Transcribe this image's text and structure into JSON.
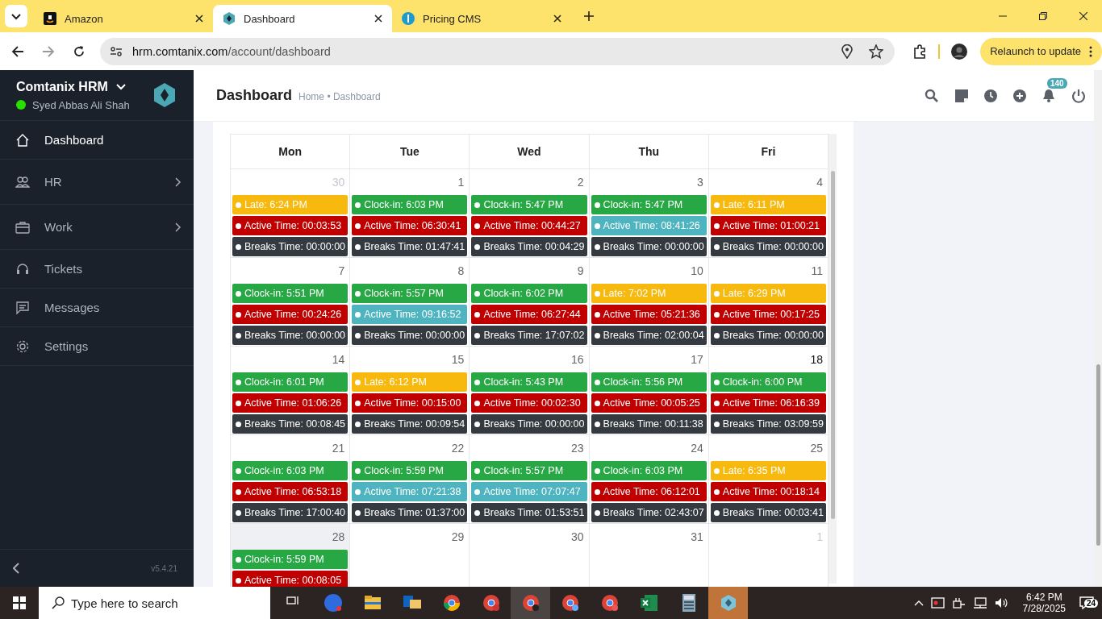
{
  "browser": {
    "tabs": [
      {
        "title": "Amazon",
        "selected": false
      },
      {
        "title": "Dashboard",
        "selected": true
      },
      {
        "title": "Pricing CMS",
        "selected": false
      }
    ],
    "url_host": "hrm.comtanix.com",
    "url_path": "/account/dashboard",
    "relaunch": "Relaunch to update"
  },
  "sidebar": {
    "app_name": "Comtanix HRM",
    "user": "Syed Abbas Ali Shah",
    "online": true,
    "items": [
      {
        "label": "Dashboard",
        "selected": true,
        "expandable": false
      },
      {
        "label": "HR",
        "selected": false,
        "expandable": true
      },
      {
        "label": "Work",
        "selected": false,
        "expandable": true
      },
      {
        "label": "Tickets",
        "selected": false,
        "expandable": false
      },
      {
        "label": "Messages",
        "selected": false,
        "expandable": false
      },
      {
        "label": "Settings",
        "selected": false,
        "expandable": false
      }
    ],
    "version": "v5.4.21"
  },
  "header": {
    "title": "Dashboard",
    "breadcrumb": "Home • Dashboard",
    "notifications": "140"
  },
  "calendar": {
    "columns": [
      "Mon",
      "Tue",
      "Wed",
      "Thu",
      "Fri"
    ],
    "weeks": [
      [
        {
          "day": "30",
          "muted": true,
          "today": false,
          "events": [
            {
              "text": "Late: 6:24 PM",
              "color": "#f8b90f"
            },
            {
              "text": "Active Time: 00:03:53",
              "color": "#c00000"
            },
            {
              "text": "Breaks Time: 00:00:00",
              "color": "#343a40"
            }
          ]
        },
        {
          "day": "1",
          "muted": false,
          "today": false,
          "events": [
            {
              "text": "Clock-in: 6:03 PM",
              "color": "#28a745"
            },
            {
              "text": "Active Time: 06:30:41",
              "color": "#c00000"
            },
            {
              "text": "Breaks Time: 01:47:41",
              "color": "#343a40"
            }
          ]
        },
        {
          "day": "2",
          "muted": false,
          "today": false,
          "events": [
            {
              "text": "Clock-in: 5:47 PM",
              "color": "#28a745"
            },
            {
              "text": "Active Time: 00:44:27",
              "color": "#c00000"
            },
            {
              "text": "Breaks Time: 00:04:29",
              "color": "#343a40"
            }
          ]
        },
        {
          "day": "3",
          "muted": false,
          "today": false,
          "events": [
            {
              "text": "Clock-in: 5:47 PM",
              "color": "#28a745"
            },
            {
              "text": "Active Time: 08:41:26",
              "color": "#4eb4bf"
            },
            {
              "text": "Breaks Time: 00:00:00",
              "color": "#343a40"
            }
          ]
        },
        {
          "day": "4",
          "muted": false,
          "today": false,
          "events": [
            {
              "text": "Late: 6:11 PM",
              "color": "#f8b90f"
            },
            {
              "text": "Active Time: 01:00:21",
              "color": "#c00000"
            },
            {
              "text": "Breaks Time: 00:00:00",
              "color": "#343a40"
            }
          ]
        }
      ],
      [
        {
          "day": "7",
          "muted": false,
          "today": false,
          "events": [
            {
              "text": "Clock-in: 5:51 PM",
              "color": "#28a745"
            },
            {
              "text": "Active Time: 00:24:26",
              "color": "#c00000"
            },
            {
              "text": "Breaks Time: 00:00:00",
              "color": "#343a40"
            }
          ]
        },
        {
          "day": "8",
          "muted": false,
          "today": false,
          "events": [
            {
              "text": "Clock-in: 5:57 PM",
              "color": "#28a745"
            },
            {
              "text": "Active Time: 09:16:52",
              "color": "#4eb4bf"
            },
            {
              "text": "Breaks Time: 00:00:00",
              "color": "#343a40"
            }
          ]
        },
        {
          "day": "9",
          "muted": false,
          "today": false,
          "events": [
            {
              "text": "Clock-in: 6:02 PM",
              "color": "#28a745"
            },
            {
              "text": "Active Time: 06:27:44",
              "color": "#c00000"
            },
            {
              "text": "Breaks Time: 17:07:02",
              "color": "#343a40"
            }
          ]
        },
        {
          "day": "10",
          "muted": false,
          "today": false,
          "events": [
            {
              "text": "Late: 7:02 PM",
              "color": "#f8b90f"
            },
            {
              "text": "Active Time: 05:21:36",
              "color": "#c00000"
            },
            {
              "text": "Breaks Time: 02:00:04",
              "color": "#343a40"
            }
          ]
        },
        {
          "day": "11",
          "muted": false,
          "today": false,
          "events": [
            {
              "text": "Late: 6:29 PM",
              "color": "#f8b90f"
            },
            {
              "text": "Active Time: 00:17:25",
              "color": "#c00000"
            },
            {
              "text": "Breaks Time: 00:00:00",
              "color": "#343a40"
            }
          ]
        }
      ],
      [
        {
          "day": "14",
          "muted": false,
          "today": false,
          "events": [
            {
              "text": "Clock-in: 6:01 PM",
              "color": "#28a745"
            },
            {
              "text": "Active Time: 01:06:26",
              "color": "#c00000"
            },
            {
              "text": "Breaks Time: 00:08:45",
              "color": "#343a40"
            }
          ]
        },
        {
          "day": "15",
          "muted": false,
          "today": false,
          "events": [
            {
              "text": "Late: 6:12 PM",
              "color": "#f8b90f"
            },
            {
              "text": "Active Time: 00:15:00",
              "color": "#c00000"
            },
            {
              "text": "Breaks Time: 00:09:54",
              "color": "#343a40"
            }
          ]
        },
        {
          "day": "16",
          "muted": false,
          "today": false,
          "events": [
            {
              "text": "Clock-in: 5:43 PM",
              "color": "#28a745"
            },
            {
              "text": "Active Time: 00:02:30",
              "color": "#c00000"
            },
            {
              "text": "Breaks Time: 00:00:00",
              "color": "#343a40"
            }
          ]
        },
        {
          "day": "17",
          "muted": false,
          "today": false,
          "events": [
            {
              "text": "Clock-in: 5:56 PM",
              "color": "#28a745"
            },
            {
              "text": "Active Time: 00:05:25",
              "color": "#c00000"
            },
            {
              "text": "Breaks Time: 00:11:38",
              "color": "#343a40"
            }
          ]
        },
        {
          "day": "18",
          "muted": false,
          "today": true,
          "events": [
            {
              "text": "Clock-in: 6:00 PM",
              "color": "#28a745"
            },
            {
              "text": "Active Time: 06:16:39",
              "color": "#c00000"
            },
            {
              "text": "Breaks Time: 03:09:59",
              "color": "#343a40"
            }
          ]
        }
      ],
      [
        {
          "day": "21",
          "muted": false,
          "today": false,
          "events": [
            {
              "text": "Clock-in: 6:03 PM",
              "color": "#28a745"
            },
            {
              "text": "Active Time: 06:53:18",
              "color": "#c00000"
            },
            {
              "text": "Breaks Time: 17:00:40",
              "color": "#343a40"
            }
          ]
        },
        {
          "day": "22",
          "muted": false,
          "today": false,
          "events": [
            {
              "text": "Clock-in: 5:59 PM",
              "color": "#28a745"
            },
            {
              "text": "Active Time: 07:21:38",
              "color": "#4eb4bf"
            },
            {
              "text": "Breaks Time: 01:37:00",
              "color": "#343a40"
            }
          ]
        },
        {
          "day": "23",
          "muted": false,
          "today": false,
          "events": [
            {
              "text": "Clock-in: 5:57 PM",
              "color": "#28a745"
            },
            {
              "text": "Active Time: 07:07:47",
              "color": "#4eb4bf"
            },
            {
              "text": "Breaks Time: 01:53:51",
              "color": "#343a40"
            }
          ]
        },
        {
          "day": "24",
          "muted": false,
          "today": false,
          "events": [
            {
              "text": "Clock-in: 6:03 PM",
              "color": "#28a745"
            },
            {
              "text": "Active Time: 06:12:01",
              "color": "#c00000"
            },
            {
              "text": "Breaks Time: 02:43:07",
              "color": "#343a40"
            }
          ]
        },
        {
          "day": "25",
          "muted": false,
          "today": false,
          "events": [
            {
              "text": "Late: 6:35 PM",
              "color": "#f8b90f"
            },
            {
              "text": "Active Time: 00:18:14",
              "color": "#c00000"
            },
            {
              "text": "Breaks Time: 00:03:41",
              "color": "#343a40"
            }
          ]
        }
      ],
      [
        {
          "day": "28",
          "muted": false,
          "today": false,
          "shaded": true,
          "events": [
            {
              "text": "Clock-in: 5:59 PM",
              "color": "#28a745"
            },
            {
              "text": "Active Time: 00:08:05",
              "color": "#c00000"
            }
          ]
        },
        {
          "day": "29",
          "muted": false,
          "today": false
        },
        {
          "day": "30",
          "muted": false,
          "today": false
        },
        {
          "day": "31",
          "muted": false,
          "today": false
        },
        {
          "day": "1",
          "muted": true,
          "today": false
        }
      ]
    ]
  },
  "taskbar": {
    "search_placeholder": "Type here to search",
    "time": "6:42 PM",
    "date": "7/28/2025",
    "notification_count": "24"
  }
}
